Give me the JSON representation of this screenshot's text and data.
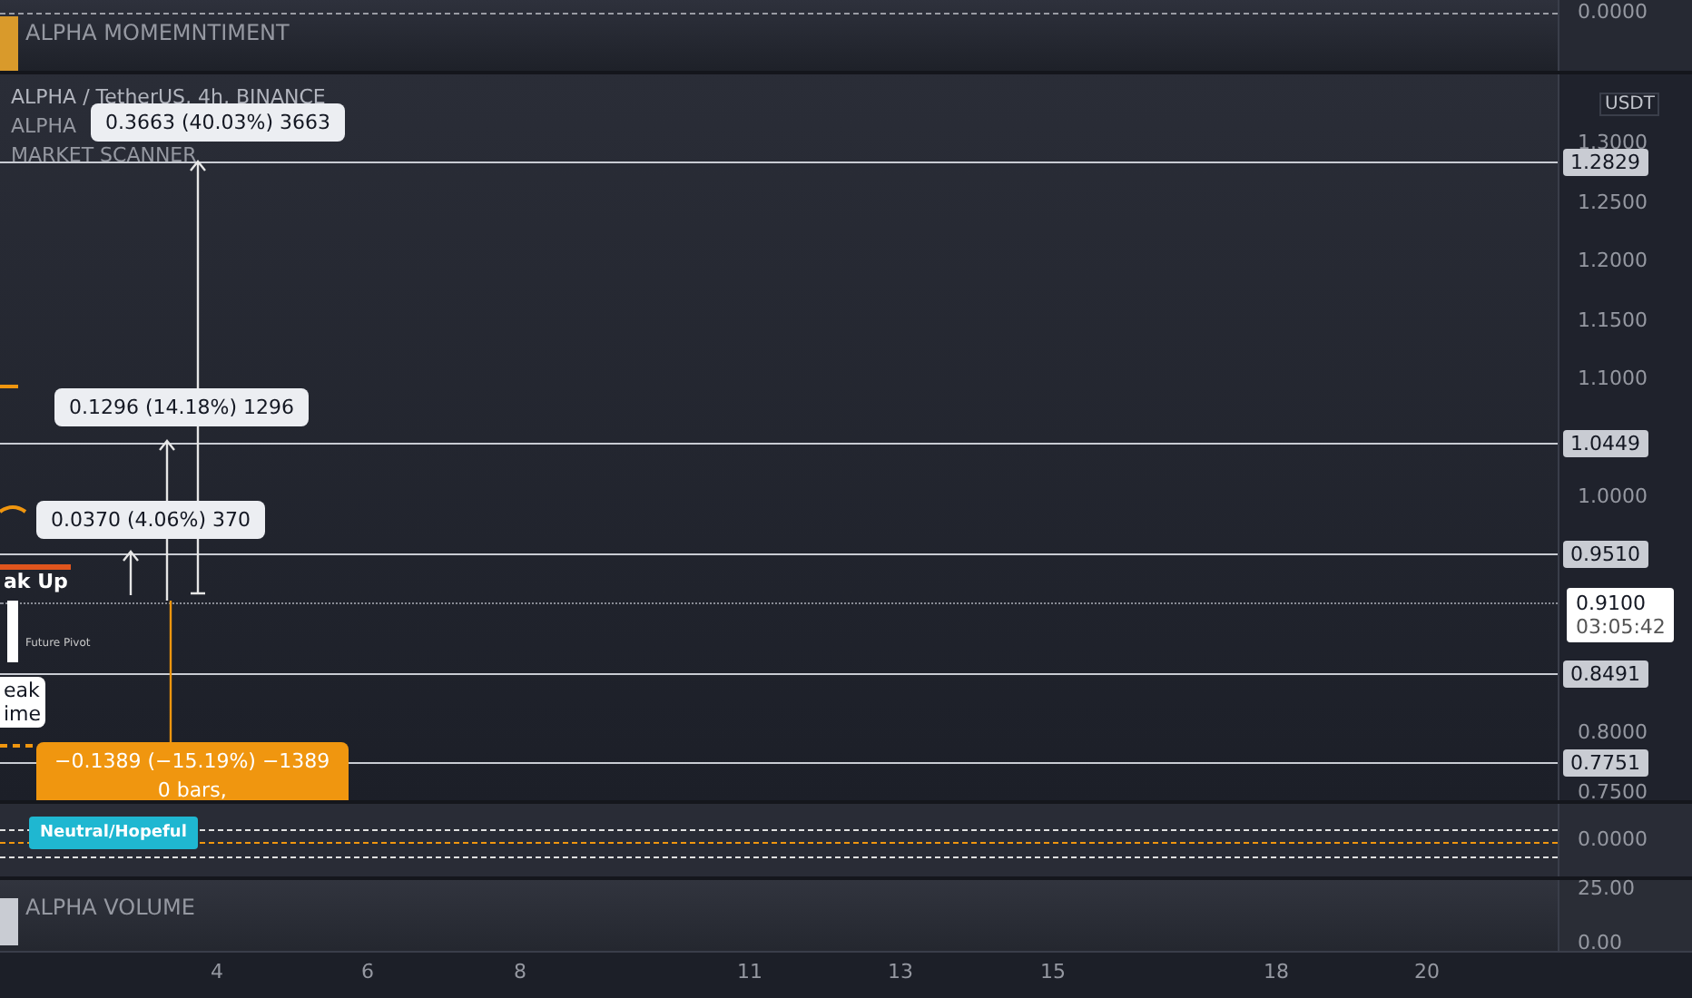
{
  "momentum_pane": {
    "title": "ALPHA MOMEMNTIMENT",
    "axis_label": "0.0000"
  },
  "main_chart": {
    "symbol_title": "ALPHA / TetherUS, 4h, BINANCE",
    "indicators": [
      "ALPHA",
      "MARKET SCANNER"
    ],
    "currency": "USDT",
    "price_ticks": [
      "1.3000",
      "1.2500",
      "1.2000",
      "1.1500",
      "1.1000",
      "1.0000",
      "0.8000",
      "0.7500"
    ],
    "price_lines": [
      {
        "price": "1.2829"
      },
      {
        "price": "1.0449"
      },
      {
        "price": "0.9510"
      },
      {
        "price": "0.8491"
      },
      {
        "price": "0.7751"
      }
    ],
    "current_price": {
      "price": "0.9100",
      "countdown": "03:05:42"
    },
    "measurements": [
      {
        "kind": "up",
        "label": "0.3663 (40.03%) 3663"
      },
      {
        "kind": "up",
        "label": "0.1296 (14.18%) 1296"
      },
      {
        "kind": "up",
        "label": "0.0370 (4.06%) 370"
      },
      {
        "kind": "down",
        "label": "−0.1389 (−15.19%) −1389",
        "bars": "0 bars,"
      }
    ],
    "signals": [
      {
        "kind": "break",
        "text": "ak Up"
      },
      {
        "kind": "pivot",
        "text": "Future Pivot"
      },
      {
        "kind": "box",
        "lines": [
          "eak",
          "ime"
        ]
      }
    ]
  },
  "wave_pane": {
    "badge": "Neutral/Hopeful",
    "axis_label": "0.0000"
  },
  "volume_pane": {
    "title": "ALPHA VOLUME",
    "axis_labels": [
      "25.00",
      "0.00"
    ]
  },
  "time_axis": [
    "4",
    "6",
    "8",
    "11",
    "13",
    "15",
    "18",
    "20"
  ]
}
